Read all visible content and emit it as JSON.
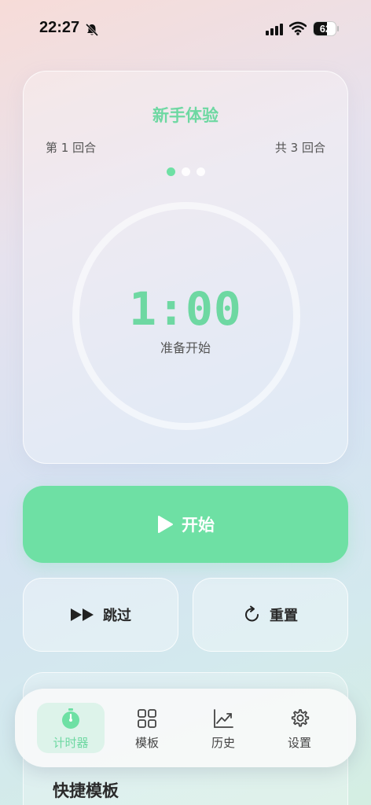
{
  "status_bar": {
    "time": "22:27",
    "battery": "62",
    "battery_level": 0.62
  },
  "timer_card": {
    "title": "新手体验",
    "round_current": "第 1 回合",
    "round_total": "共 3 回合",
    "round_dots": 3,
    "active_dot": 0,
    "time": "1:00",
    "status": "准备开始",
    "accent_color": "#6ee0a4"
  },
  "controls": {
    "start_label": "开始",
    "skip_label": "跳过",
    "reset_label": "重置"
  },
  "quick_templates": {
    "title": "快捷模板"
  },
  "tab_bar": {
    "tabs": [
      {
        "label": "计时器",
        "icon": "stopwatch-icon",
        "active": true
      },
      {
        "label": "模板",
        "icon": "grid-icon",
        "active": false
      },
      {
        "label": "历史",
        "icon": "chart-line-icon",
        "active": false
      },
      {
        "label": "设置",
        "icon": "gear-icon",
        "active": false
      }
    ]
  }
}
